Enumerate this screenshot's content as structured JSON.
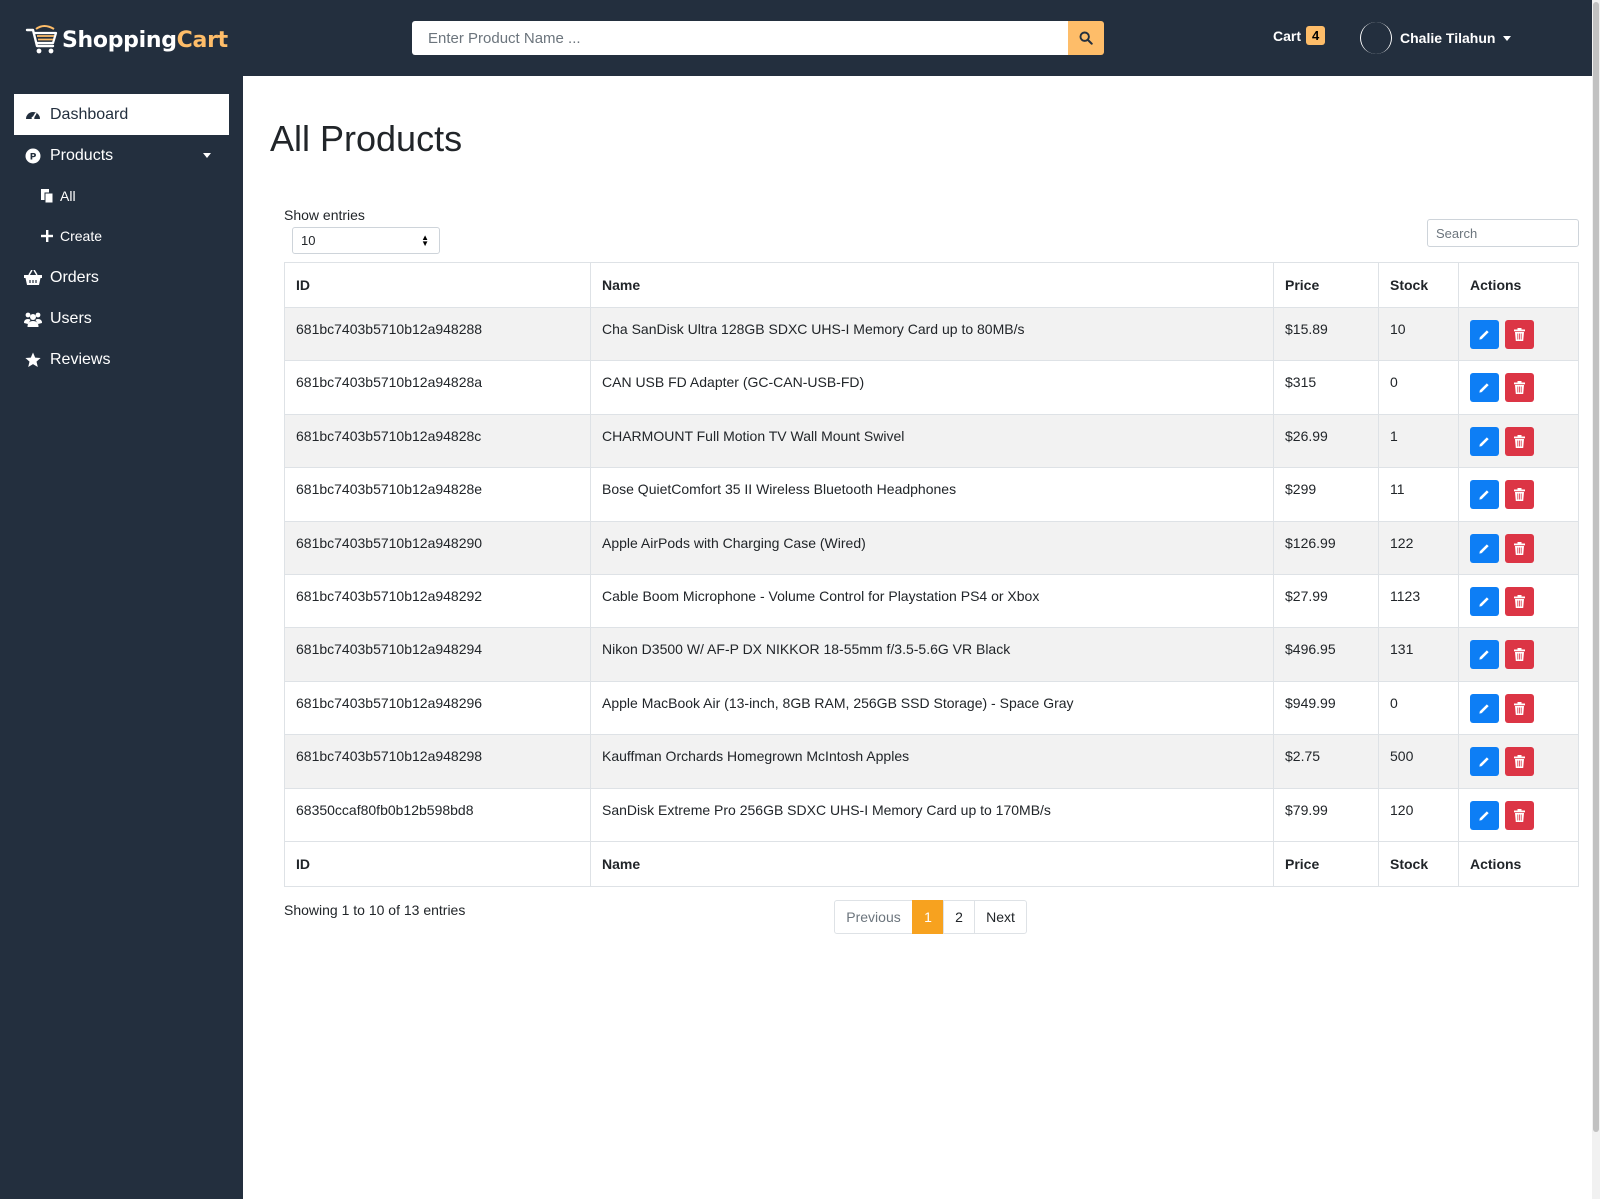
{
  "header": {
    "logo_main": "Shopping",
    "logo_accent": "Cart",
    "search_placeholder": "Enter Product Name ...",
    "cart_label": "Cart",
    "cart_count": "4",
    "user_name": "Chalie Tilahun",
    "accent_color": "#febd69"
  },
  "sidebar": {
    "dashboard": "Dashboard",
    "products": "Products",
    "all": "All",
    "create": "Create",
    "orders": "Orders",
    "users": "Users",
    "reviews": "Reviews"
  },
  "main": {
    "title": "All Products",
    "show_entries_label": "Show entries",
    "entries_value": "10",
    "search_placeholder": "Search",
    "columns": [
      "ID",
      "Name",
      "Price",
      "Stock",
      "Actions"
    ],
    "rows": [
      {
        "id": "681bc7403b5710b12a948288",
        "name": "Cha SanDisk Ultra 128GB SDXC UHS-I Memory Card up to 80MB/s",
        "price": "$15.89",
        "stock": "10"
      },
      {
        "id": "681bc7403b5710b12a94828a",
        "name": "CAN USB FD Adapter (GC-CAN-USB-FD)",
        "price": "$315",
        "stock": "0"
      },
      {
        "id": "681bc7403b5710b12a94828c",
        "name": "CHARMOUNT Full Motion TV Wall Mount Swivel",
        "price": "$26.99",
        "stock": "1"
      },
      {
        "id": "681bc7403b5710b12a94828e",
        "name": "Bose QuietComfort 35 II Wireless Bluetooth Headphones",
        "price": "$299",
        "stock": "11"
      },
      {
        "id": "681bc7403b5710b12a948290",
        "name": "Apple AirPods with Charging Case (Wired)",
        "price": "$126.99",
        "stock": "122"
      },
      {
        "id": "681bc7403b5710b12a948292",
        "name": "Cable Boom Microphone - Volume Control for Playstation PS4 or Xbox",
        "price": "$27.99",
        "stock": "1123"
      },
      {
        "id": "681bc7403b5710b12a948294",
        "name": "Nikon D3500 W/ AF-P DX NIKKOR 18-55mm f/3.5-5.6G VR Black",
        "price": "$496.95",
        "stock": "131"
      },
      {
        "id": "681bc7403b5710b12a948296",
        "name": "Apple MacBook Air (13-inch, 8GB RAM, 256GB SSD Storage) - Space Gray",
        "price": "$949.99",
        "stock": "0"
      },
      {
        "id": "681bc7403b5710b12a948298",
        "name": "Kauffman Orchards Homegrown McIntosh Apples",
        "price": "$2.75",
        "stock": "500"
      },
      {
        "id": "68350ccaf80fb0b12b598bd8",
        "name": "SanDisk Extreme Pro 256GB SDXC UHS-I Memory Card up to 170MB/s",
        "price": "$79.99",
        "stock": "120"
      }
    ],
    "info": "Showing 1 to 10 of 13 entries",
    "pagination": {
      "previous": "Previous",
      "page1": "1",
      "page2": "2",
      "next": "Next"
    }
  }
}
